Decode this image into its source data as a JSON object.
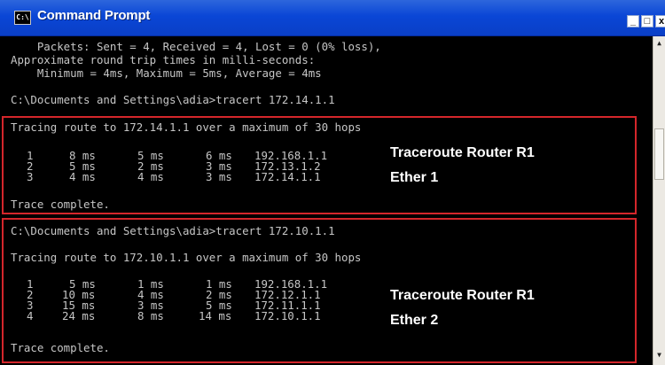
{
  "window": {
    "title": "Command Prompt",
    "icon_label": "C:\\",
    "controls": {
      "minimize": "_",
      "maximize": "□",
      "close": "x"
    }
  },
  "console": {
    "lines": [
      "    Packets: Sent = 4, Received = 4, Lost = 0 (0% loss),",
      "Approximate round trip times in milli-seconds:",
      "    Minimum = 4ms, Maximum = 5ms, Average = 4ms",
      "",
      "C:\\Documents and Settings\\adia>tracert 172.14.1.1",
      "Tracing route to 172.14.1.1 over a maximum of 30 hops",
      "Trace complete.",
      "C:\\Documents and Settings\\adia>tracert 172.10.1.1",
      "Tracing route to 172.10.1.1 over a maximum of 30 hops",
      "Trace complete."
    ],
    "trace1_hops": [
      {
        "hop": "1",
        "t1": "8 ms",
        "t2": "5 ms",
        "t3": "6 ms",
        "ip": "192.168.1.1"
      },
      {
        "hop": "2",
        "t1": "5 ms",
        "t2": "2 ms",
        "t3": "3 ms",
        "ip": "172.13.1.2"
      },
      {
        "hop": "3",
        "t1": "4 ms",
        "t2": "4 ms",
        "t3": "3 ms",
        "ip": "172.14.1.1"
      }
    ],
    "trace2_hops": [
      {
        "hop": "1",
        "t1": "5 ms",
        "t2": "1 ms",
        "t3": "1 ms",
        "ip": "192.168.1.1"
      },
      {
        "hop": "2",
        "t1": "10 ms",
        "t2": "4 ms",
        "t3": "2 ms",
        "ip": "172.12.1.1"
      },
      {
        "hop": "3",
        "t1": "15 ms",
        "t2": "3 ms",
        "t3": "5 ms",
        "ip": "172.11.1.1"
      },
      {
        "hop": "4",
        "t1": "24 ms",
        "t2": "8 ms",
        "t3": "14 ms",
        "ip": "172.10.1.1"
      }
    ]
  },
  "annotations": {
    "trace1_title": "Traceroute Router R1",
    "trace1_sub": "Ether 1",
    "trace2_title": "Traceroute Router R1",
    "trace2_sub": "Ether 2"
  },
  "colors": {
    "annotation_box": "#d4262b",
    "console_text": "#c6c6c6",
    "titlebar": "#0a46d6"
  }
}
